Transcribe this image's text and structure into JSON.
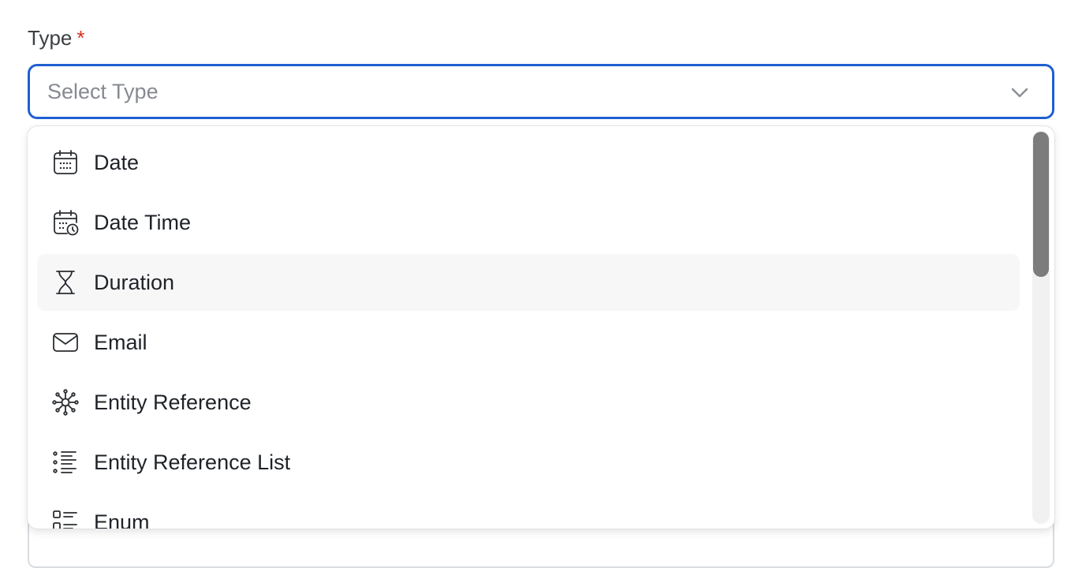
{
  "field": {
    "label": "Type",
    "required_mark": "*",
    "placeholder": "Select Type"
  },
  "dropdown": {
    "items": [
      {
        "label": "Date",
        "icon": "calendar-icon"
      },
      {
        "label": "Date Time",
        "icon": "calendar-clock-icon"
      },
      {
        "label": "Duration",
        "icon": "hourglass-icon"
      },
      {
        "label": "Email",
        "icon": "envelope-icon"
      },
      {
        "label": "Entity Reference",
        "icon": "network-icon"
      },
      {
        "label": "Entity Reference List",
        "icon": "list-icon"
      },
      {
        "label": "Enum",
        "icon": "enum-list-icon"
      }
    ],
    "hovered_index": 2
  },
  "colors": {
    "focus_border": "#1f5fd1",
    "required": "#d92d20",
    "hover_bg": "#f7f7f8",
    "scroll_thumb": "#7c7c7c"
  }
}
